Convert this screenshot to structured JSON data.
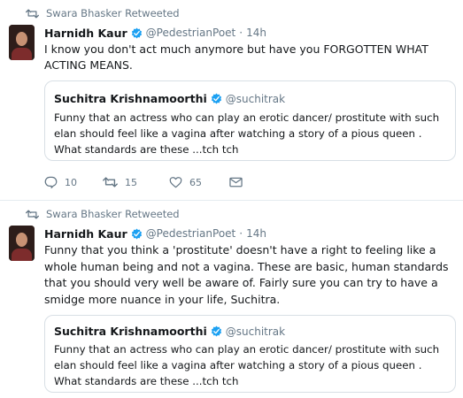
{
  "tweets": [
    {
      "retweet_label": "Swara Bhasker Retweeted",
      "author_name": "Harnidh Kaur",
      "author_handle": "@PedestrianPoet",
      "time": "14h",
      "text": "I know you don't act much anymore but have you FORGOTTEN WHAT ACTING MEANS.",
      "quote": {
        "author_name": "Suchitra Krishnamoorthi",
        "author_handle": "@suchitrak",
        "text": "Funny that an actress who can play an erotic dancer/ prostitute with such elan  should feel like a vagina after watching a story of a pious queen . What standards are these ...tch tch"
      },
      "actions": {
        "replies": "10",
        "retweets": "15",
        "likes": "65"
      }
    },
    {
      "retweet_label": "Swara Bhasker Retweeted",
      "author_name": "Harnidh Kaur",
      "author_handle": "@PedestrianPoet",
      "time": "14h",
      "text": "Funny that you think a 'prostitute' doesn't have a right to feeling like a whole human being and not a vagina. These are basic, human standards that you should very well be aware of. Fairly sure you can try to have a smidge more nuance in your life, Suchitra.",
      "quote": {
        "author_name": "Suchitra Krishnamoorthi",
        "author_handle": "@suchitrak",
        "text": "Funny that an actress who can play an erotic dancer/ prostitute with such elan  should feel like a vagina after watching a story of a pious queen . What standards are these ...tch tch"
      }
    }
  ],
  "icons": {
    "retweet": "retweet-icon",
    "verified": "verified-badge-icon",
    "reply": "reply-icon",
    "like": "heart-icon",
    "message": "envelope-icon"
  },
  "colors": {
    "verified_blue": "#1da1f2",
    "secondary_text": "#657786",
    "border": "#d8dfe5"
  }
}
